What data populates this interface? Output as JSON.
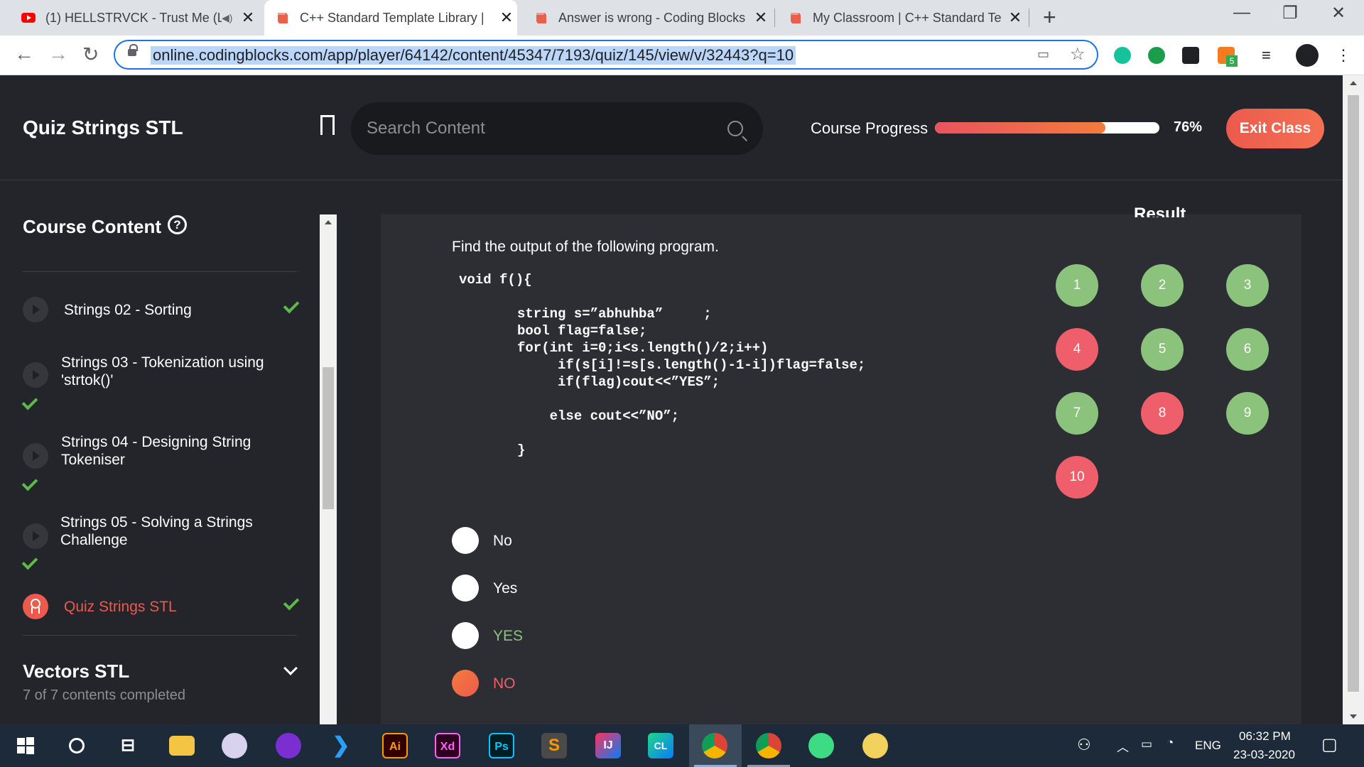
{
  "browser": {
    "tabs": [
      {
        "title": "(1) HELLSTRVCK - Trust Me (L",
        "favicon": "youtube-icon",
        "active": false
      },
      {
        "title": "C++ Standard Template Library |",
        "favicon": "codingblocks-icon",
        "active": true
      },
      {
        "title": "Answer is wrong - Coding Blocks",
        "favicon": "codingblocks-icon",
        "active": false
      },
      {
        "title": "My Classroom | C++ Standard Te",
        "favicon": "codingblocks-icon",
        "active": false
      }
    ],
    "close_glyph": "✕",
    "new_tab_glyph": "+",
    "url": "online.codingblocks.com/app/player/64142/content/45347/7193/quiz/145/view/v/32443?q=10",
    "extension_badge": "5"
  },
  "header": {
    "title": "Quiz Strings STL",
    "search_placeholder": "Search Content",
    "progress_label": "Course Progress",
    "progress_percent": 76,
    "progress_text": "76%",
    "exit_label": "Exit Class"
  },
  "sidebar": {
    "title": "Course Content",
    "help_glyph": "?",
    "lessons": [
      {
        "title": "Strings 02 - Sorting",
        "completed": true
      },
      {
        "title": "Strings 03 - Tokenization using 'strtok()'",
        "completed": true
      },
      {
        "title": "Strings 04 - Designing String Tokeniser",
        "completed": true
      },
      {
        "title": "Strings 05 - Solving a Strings Challenge",
        "completed": true
      },
      {
        "title": "Quiz Strings STL",
        "completed": true,
        "current": true
      }
    ],
    "next_section": {
      "title": "Vectors STL",
      "subtitle": "7 of 7 contents completed"
    }
  },
  "quiz": {
    "question": "Find the output of the following program.",
    "code_lines": [
      "void f(){",
      "string s=”abhuhba”     ;",
      "bool flag=false;",
      "for(int i=0;i<s.length()/2;i++)",
      "     if(s[i]!=s[s.length()-1-i])flag=false;",
      "     if(flag)cout<<”YES”;",
      "    else cout<<”NO”;",
      "}"
    ],
    "options": [
      {
        "label": "No",
        "selected": false,
        "color": "#ffffff"
      },
      {
        "label": "Yes",
        "selected": false,
        "color": "#ffffff"
      },
      {
        "label": "YES",
        "selected": false,
        "color": "#8bc37c"
      },
      {
        "label": "NO",
        "selected": true,
        "color": "#ef5f6b"
      }
    ],
    "result_title": "Result",
    "question_buttons": [
      {
        "number": "1",
        "status": "correct"
      },
      {
        "number": "2",
        "status": "correct"
      },
      {
        "number": "3",
        "status": "correct"
      },
      {
        "number": "4",
        "status": "wrong"
      },
      {
        "number": "5",
        "status": "correct"
      },
      {
        "number": "6",
        "status": "correct"
      },
      {
        "number": "7",
        "status": "correct"
      },
      {
        "number": "8",
        "status": "wrong"
      },
      {
        "number": "9",
        "status": "correct"
      },
      {
        "number": "10",
        "status": "wrong"
      }
    ]
  },
  "colors": {
    "accent": "#ec5a4e",
    "correct": "#8bc37c",
    "wrong": "#ef5f6b",
    "check": "#5dba4a"
  },
  "taskbar": {
    "apps": [
      "windows-icon",
      "search-icon",
      "task-view-icon",
      "file-explorer-icon",
      "github-icon",
      "podcast-icon",
      "vscode-icon",
      "illustrator-icon",
      "xd-icon",
      "photoshop-icon",
      "sublime-icon",
      "intellij-icon",
      "clion-icon",
      "chrome-icon",
      "chrome-canary-icon",
      "android-studio-icon",
      "app-icon"
    ],
    "illustrator_label": "Ai",
    "xd_label": "Xd",
    "photoshop_label": "Ps",
    "intellij_label": "IJ",
    "clion_label": "CL",
    "language": "ENG",
    "time": "06:32 PM",
    "date": "23-03-2020"
  }
}
